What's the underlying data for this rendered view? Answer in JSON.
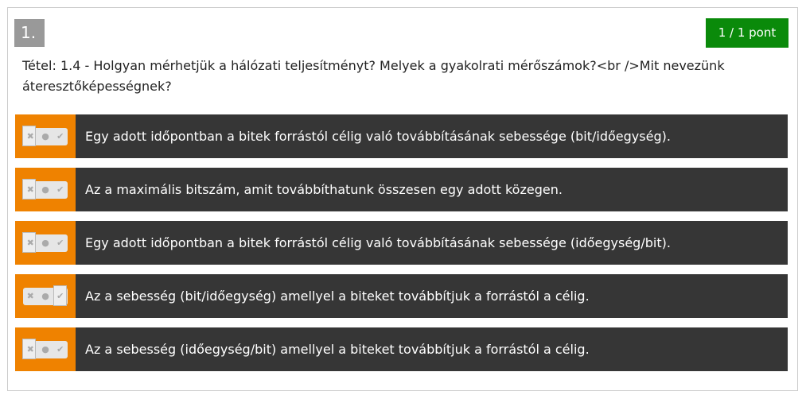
{
  "question": {
    "number": "1.",
    "score": "1 / 1 pont",
    "text": "Tétel: 1.4 - Holgyan mérhetjük a hálózati teljesítményt? Melyek a gyakolrati mérőszámok?<br />Mit nevezünk áteresztőképességnek?"
  },
  "colors": {
    "accent": "#ef8200",
    "row": "#363636",
    "score": "#0a8a0a"
  },
  "answers": [
    {
      "text": "Egy adott időpontban a bitek forrástól célig való továbbításának sebessége (bit/időegység).",
      "state": "false"
    },
    {
      "text": "Az a maximális bitszám, amit továbbíthatunk összesen egy adott közegen.",
      "state": "false"
    },
    {
      "text": "Egy adott időpontban a bitek forrástól célig való továbbításának sebessége (időegység/bit).",
      "state": "false"
    },
    {
      "text": "Az a sebesség (bit/időegység) amellyel a biteket továbbítjuk a forrástól a célig.",
      "state": "true"
    },
    {
      "text": "Az a sebesség (időegység/bit) amellyel a biteket továbbítjuk a forrástól a célig.",
      "state": "false"
    }
  ]
}
